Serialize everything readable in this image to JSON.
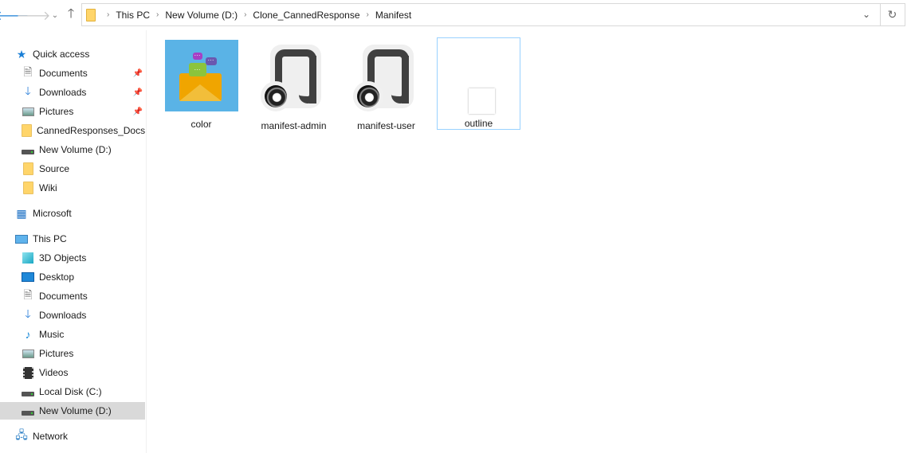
{
  "toolbar": {
    "back_icon": "arrow-left-icon",
    "forward_icon": "arrow-right-icon",
    "recent_icon": "chevron-down-icon",
    "up_icon": "arrow-up-icon",
    "refresh_icon": "refresh-icon"
  },
  "address": {
    "crumbs": [
      "This PC",
      "New Volume (D:)",
      "Clone_CannedResponse",
      "Manifest"
    ]
  },
  "sidebar": {
    "quick_access": "Quick access",
    "quick_items": [
      {
        "label": "Documents",
        "pinned": true
      },
      {
        "label": "Downloads",
        "pinned": true
      },
      {
        "label": "Pictures",
        "pinned": true
      },
      {
        "label": "CannedResponses_Docs"
      },
      {
        "label": "New Volume (D:)"
      },
      {
        "label": "Source"
      },
      {
        "label": "Wiki"
      }
    ],
    "microsoft": "Microsoft",
    "this_pc": "This PC",
    "pc_items": [
      {
        "label": "3D Objects"
      },
      {
        "label": "Desktop"
      },
      {
        "label": "Documents"
      },
      {
        "label": "Downloads"
      },
      {
        "label": "Music"
      },
      {
        "label": "Pictures"
      },
      {
        "label": "Videos"
      },
      {
        "label": "Local Disk (C:)"
      },
      {
        "label": "New Volume (D:)",
        "selected": true
      }
    ],
    "network": "Network"
  },
  "files": [
    {
      "name": "color",
      "type": "image"
    },
    {
      "name": "manifest-admin",
      "type": "json"
    },
    {
      "name": "manifest-user",
      "type": "json"
    },
    {
      "name": "outline",
      "type": "image",
      "selected": true
    }
  ]
}
